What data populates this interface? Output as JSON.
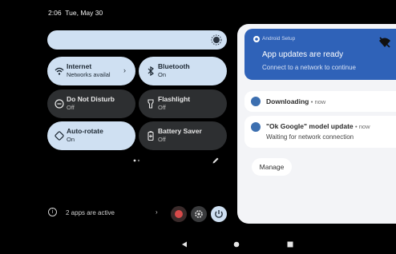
{
  "status_bar": {
    "time": "2:06",
    "date": "Tue, May 30"
  },
  "quick_tiles": [
    {
      "title": "Internet",
      "subtitle": "Networks availal",
      "state": "on",
      "icon": "wifi-icon",
      "has_chevron": true
    },
    {
      "title": "Bluetooth",
      "subtitle": "On",
      "state": "on",
      "icon": "bluetooth-icon",
      "has_chevron": false
    },
    {
      "title": "Do Not Disturb",
      "subtitle": "Off",
      "state": "off",
      "icon": "do-not-disturb-icon",
      "has_chevron": false
    },
    {
      "title": "Flashlight",
      "subtitle": "Off",
      "state": "off",
      "icon": "flashlight-icon",
      "has_chevron": false
    },
    {
      "title": "Auto-rotate",
      "subtitle": "On",
      "state": "on",
      "icon": "auto-rotate-icon",
      "has_chevron": false
    },
    {
      "title": "Battery Saver",
      "subtitle": "Off",
      "state": "off",
      "icon": "battery-saver-icon",
      "has_chevron": false
    }
  ],
  "footer": {
    "active_apps": "2 apps are active"
  },
  "notifications": {
    "setup": {
      "app_name": "Android Setup",
      "title": "App updates are ready",
      "body": "Connect to a network to continue"
    },
    "downloading": {
      "title": "Downloading",
      "time": "• now"
    },
    "ok_google": {
      "title": "\"Ok Google\" model update",
      "time": "• now",
      "body": "Waiting for network connection"
    },
    "manage_label": "Manage"
  },
  "colors": {
    "tile_on": "#cfe0f2",
    "tile_off": "#2d2f31",
    "setup_card": "#2f62b8",
    "accent_icon": "#3c6fb0"
  }
}
